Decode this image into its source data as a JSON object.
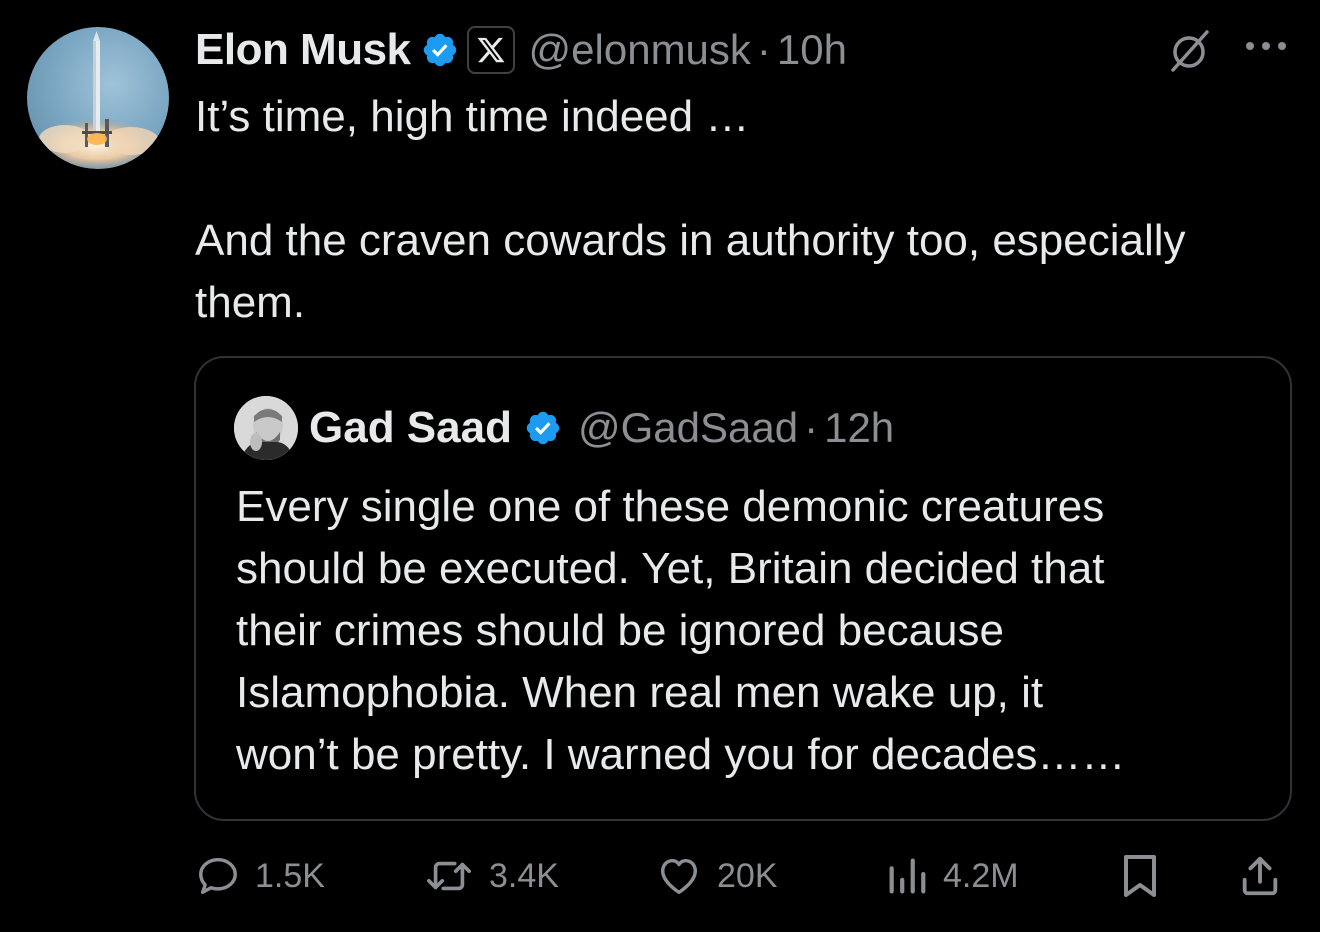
{
  "tweet": {
    "author_name": "Elon Musk",
    "handle": "@elonmusk",
    "separator": "·",
    "time": "10h",
    "text_line1": "It’s time, high time indeed …",
    "text_line2": "And the craven cowards in authority too, especially them."
  },
  "quote": {
    "author_name": "Gad Saad",
    "handle": "@GadSaad",
    "separator": "·",
    "time": "12h",
    "text": "Every single one of these demonic creatures\nshould be executed.  Yet, Britain decided that\ntheir crimes should be ignored because\nIslamophobia. When real men wake up, it\nwon’t be pretty. I warned you for decades……"
  },
  "actions": {
    "replies": "1.5K",
    "reposts": "3.4K",
    "likes": "20K",
    "views": "4.2M"
  },
  "icons": {
    "verified_badge": "verified-check-icon",
    "x_badge": "x-logo-icon",
    "grok": "grok-icon",
    "more": "more-icon",
    "reply": "reply-icon",
    "repost": "repost-icon",
    "like": "heart-icon",
    "views": "views-icon",
    "bookmark": "bookmark-icon",
    "share": "share-icon"
  },
  "colors": {
    "background": "#000000",
    "text": "#e7e9ea",
    "secondary_text": "#8b8f94",
    "verified": "#1d9bf0",
    "border": "#2f3336"
  }
}
